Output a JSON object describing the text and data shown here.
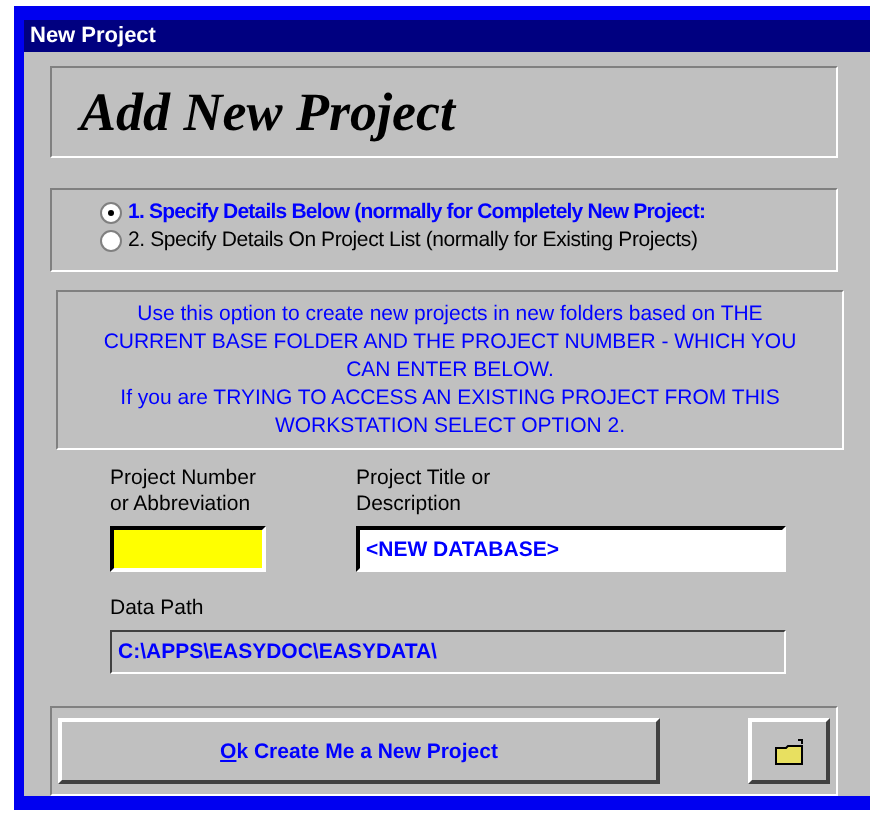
{
  "window": {
    "title": "New Project"
  },
  "heading": "Add New Project",
  "options": [
    {
      "label": "1. Specify Details Below (normally for Completely New Project:",
      "selected": true
    },
    {
      "label": "2. Specify Details On Project List (normally for Existing Projects)",
      "selected": false
    }
  ],
  "info": "Use this option to create new projects in new folders based on THE CURRENT BASE FOLDER AND THE PROJECT NUMBER - WHICH YOU CAN ENTER BELOW.\nIf you are TRYING TO ACCESS AN EXISTING PROJECT FROM THIS WORKSTATION SELECT OPTION 2.",
  "project_number": {
    "label": "Project Number\nor Abbreviation"
  },
  "project_title": {
    "label": "Project Title or\nDescription",
    "value": "<NEW DATABASE>"
  },
  "data_path": {
    "label": "Data Path",
    "value": "C:\\APPS\\EASYDOC\\EASYDATA\\"
  },
  "create_button": {
    "label": "Ok Create Me a New Project",
    "accelerator_underlined": true
  }
}
